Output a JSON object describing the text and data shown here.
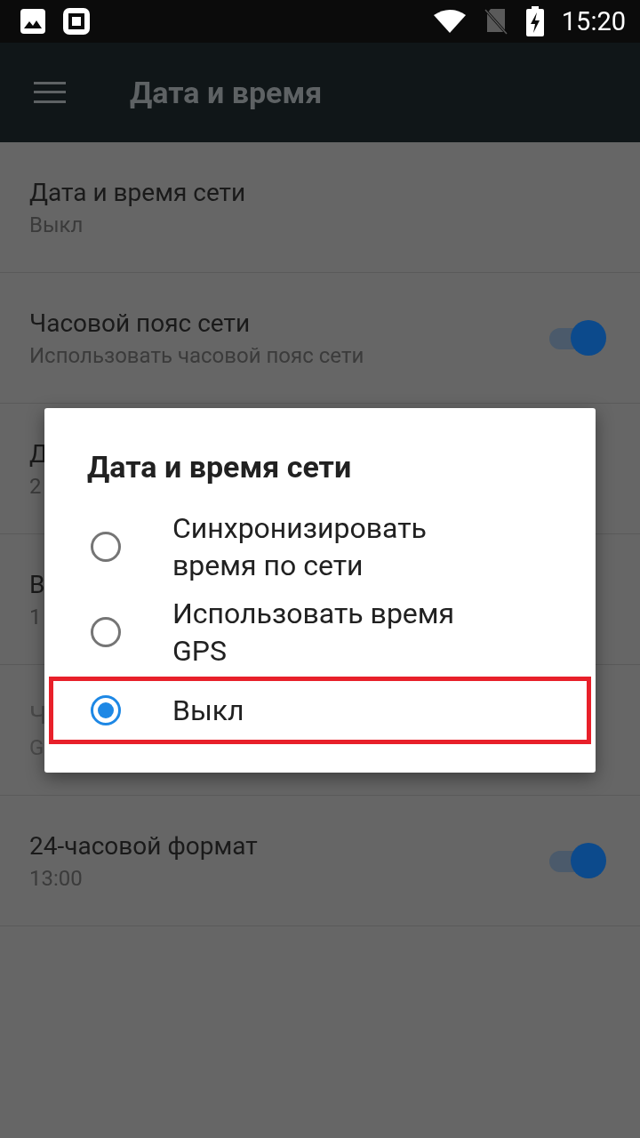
{
  "status_bar": {
    "time": "15:20"
  },
  "app_bar": {
    "title": "Дата и время"
  },
  "settings": [
    {
      "title": "Дата и время сети",
      "subtitle": "Выкл",
      "kind": "text",
      "disabled": false
    },
    {
      "title": "Часовой пояс сети",
      "subtitle": "Использовать часовой пояс сети",
      "kind": "switch",
      "on": true,
      "disabled": false
    },
    {
      "title": "Д",
      "subtitle": "2",
      "kind": "text",
      "disabled": false
    },
    {
      "title": "В",
      "subtitle": "1",
      "kind": "text",
      "disabled": false
    },
    {
      "title": "Ч",
      "subtitle": "G",
      "kind": "text",
      "disabled": true
    },
    {
      "title": "24-часовой формат",
      "subtitle": "13:00",
      "kind": "switch",
      "on": true,
      "disabled": false
    }
  ],
  "dialog": {
    "title": "Дата и время сети",
    "options": [
      {
        "label": "Синхронизировать время по сети",
        "selected": false,
        "highlighted": false
      },
      {
        "label": "Использовать время GPS",
        "selected": false,
        "highlighted": false
      },
      {
        "label": "Выкл",
        "selected": true,
        "highlighted": true
      }
    ]
  }
}
